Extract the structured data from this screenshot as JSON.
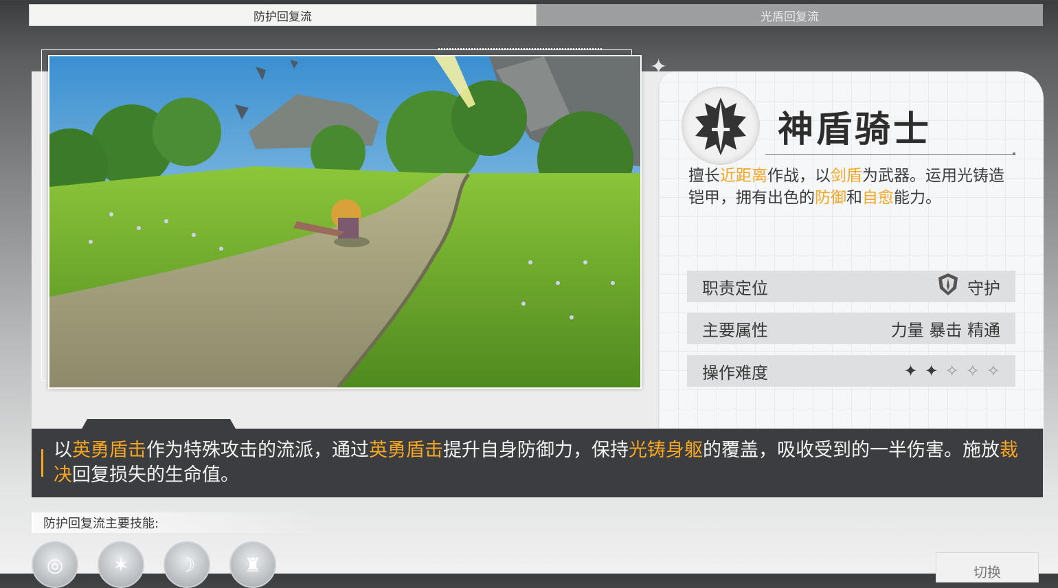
{
  "tabs": [
    {
      "label": "防护回复流",
      "active": true
    },
    {
      "label": "光盾回复流",
      "active": false
    }
  ],
  "class_info": {
    "name": "神盾骑士",
    "emblem_icon": "shield-sword-emblem-icon",
    "description": [
      {
        "text": "擅长",
        "hl": false
      },
      {
        "text": "近距离",
        "hl": true
      },
      {
        "text": "作战，以",
        "hl": false
      },
      {
        "text": "剑盾",
        "hl": true
      },
      {
        "text": "为武器。运用光铸造铠甲，拥有出色的",
        "hl": false
      },
      {
        "text": "防御",
        "hl": true
      },
      {
        "text": "和",
        "hl": false
      },
      {
        "text": "自愈",
        "hl": true
      },
      {
        "text": "能力。",
        "hl": false
      }
    ],
    "attributes": {
      "role_label": "职责定位",
      "role_value": "守护",
      "role_icon": "guardian-icon",
      "main_stat_label": "主要属性",
      "main_stat_value": "力量 暴击 精通",
      "difficulty_label": "操作难度",
      "difficulty": {
        "filled": 2,
        "total": 5
      }
    }
  },
  "build_description": {
    "segments": [
      {
        "text": "以",
        "hl": false
      },
      {
        "text": "英勇盾击",
        "hl": true
      },
      {
        "text": "作为特殊攻击的流派，通过",
        "hl": false
      },
      {
        "text": "英勇盾击",
        "hl": true
      },
      {
        "text": "提升自身防御力，保持",
        "hl": false
      },
      {
        "text": "光铸身躯",
        "hl": true
      },
      {
        "text": "的覆盖，吸收受到的一半伤害。施放",
        "hl": false
      },
      {
        "text": "裁决",
        "hl": true
      },
      {
        "text": "回复损失的生命值。",
        "hl": false
      }
    ]
  },
  "skills": {
    "label": "防护回复流主要技能:",
    "icons": [
      "skill-swirl-icon",
      "skill-star-burst-icon",
      "skill-slash-icon",
      "skill-guardian-icon"
    ]
  },
  "switch_button": "切换",
  "colors": {
    "highlight": "#f5a623",
    "dark_bar": "#3b3d40"
  }
}
